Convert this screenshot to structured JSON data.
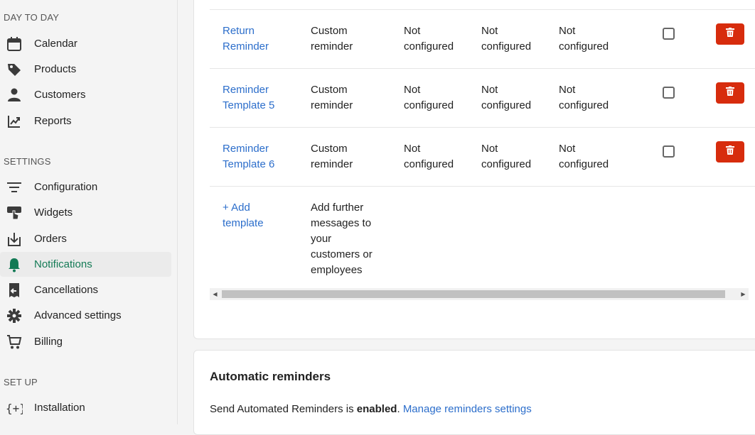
{
  "sidebar": {
    "sections": [
      {
        "title": "DAY TO DAY"
      },
      {
        "title": "SETTINGS"
      },
      {
        "title": "SET UP"
      }
    ],
    "day_to_day": [
      {
        "label": "Calendar",
        "icon": "calendar-icon"
      },
      {
        "label": "Products",
        "icon": "tag-icon"
      },
      {
        "label": "Customers",
        "icon": "person-icon"
      },
      {
        "label": "Reports",
        "icon": "reports-icon"
      }
    ],
    "settings": [
      {
        "label": "Configuration",
        "icon": "filter-lines-icon"
      },
      {
        "label": "Widgets",
        "icon": "widget-hand-icon"
      },
      {
        "label": "Orders",
        "icon": "download-box-icon"
      },
      {
        "label": "Notifications",
        "icon": "bell-icon",
        "active": true
      },
      {
        "label": "Cancellations",
        "icon": "receipt-return-icon"
      },
      {
        "label": "Advanced settings",
        "icon": "gear-icon"
      },
      {
        "label": "Billing",
        "icon": "cart-icon"
      }
    ],
    "setup": [
      {
        "label": "Installation",
        "icon": "code-braces-icon"
      }
    ]
  },
  "templates": {
    "rows": [
      {
        "name_line1": "Return",
        "name_line2": "Reminder",
        "type_line1": "Custom",
        "type_line2": "reminder",
        "col3_line1": "Not",
        "col3_line2": "configured",
        "col4_line1": "Not",
        "col4_line2": "configured",
        "col5_line1": "Not",
        "col5_line2": "configured"
      },
      {
        "name_line1": "Reminder",
        "name_line2": "Template 5",
        "type_line1": "Custom",
        "type_line2": "reminder",
        "col3_line1": "Not",
        "col3_line2": "configured",
        "col4_line1": "Not",
        "col4_line2": "configured",
        "col5_line1": "Not",
        "col5_line2": "configured"
      },
      {
        "name_line1": "Reminder",
        "name_line2": "Template 6",
        "type_line1": "Custom",
        "type_line2": "reminder",
        "col3_line1": "Not",
        "col3_line2": "configured",
        "col4_line1": "Not",
        "col4_line2": "configured",
        "col5_line1": "Not",
        "col5_line2": "configured"
      }
    ],
    "add": {
      "link_line1": "+ Add",
      "link_line2": "template",
      "desc_lines": [
        "Add further",
        "messages to",
        "your",
        "customers or",
        "employees"
      ]
    }
  },
  "automatic_reminders": {
    "title": "Automatic reminders",
    "text_prefix": "Send Automated Reminders is ",
    "status": "enabled",
    "text_suffix": ". ",
    "link": "Manage reminders settings"
  },
  "colors": {
    "accent_green": "#137a55",
    "link_blue": "#2c6ecb",
    "danger_red": "#d72c0d"
  }
}
